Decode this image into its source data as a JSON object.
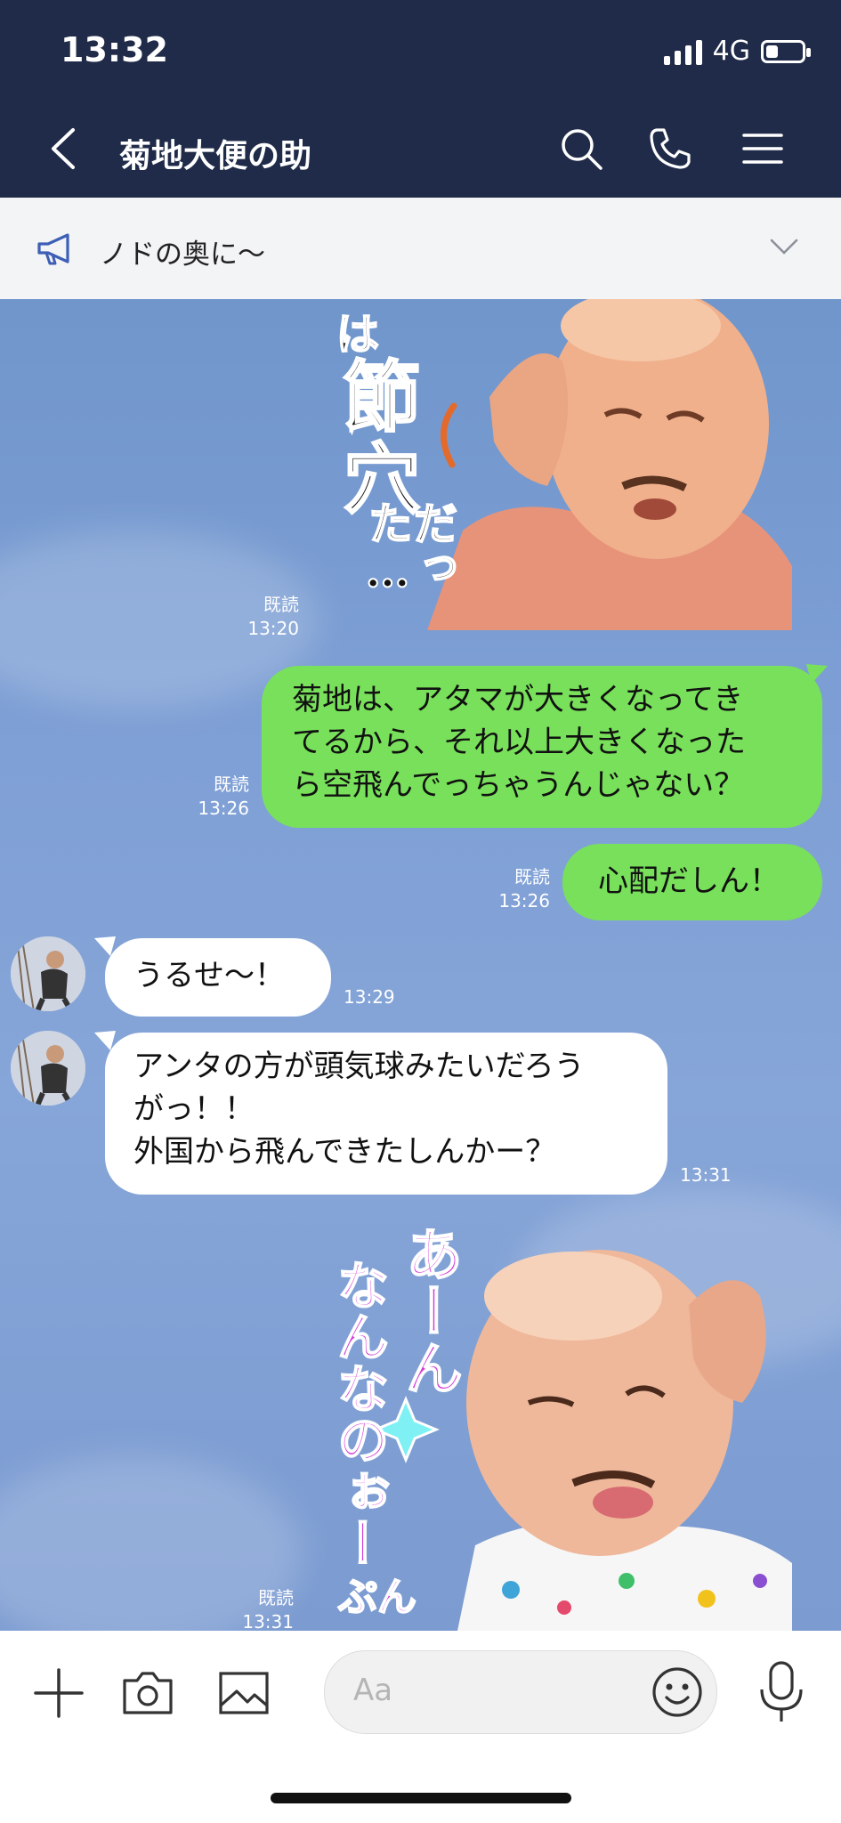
{
  "status": {
    "time": "13:32",
    "network": "4G",
    "battery_level": 0.35
  },
  "header": {
    "title": "菊地大便の助"
  },
  "announcement": {
    "text": "ノドの奥に〜"
  },
  "messages": {
    "m1": {
      "read": "既読",
      "time": "13:20",
      "sticker_text": [
        "は",
        "節",
        "穴",
        "だった…"
      ]
    },
    "m2": {
      "read": "既読",
      "time": "13:26",
      "line1": "菊地は、アタマが大きくなってき",
      "line2": "てるから、それ以上大きくなった",
      "line3": "ら空飛んでっちゃうんじゃない？"
    },
    "m3": {
      "read": "既読",
      "time": "13:26",
      "text": "心配だしん！"
    },
    "m4": {
      "time": "13:29",
      "text": "うるせ〜！"
    },
    "m5": {
      "time": "13:31",
      "line1": "アンタの方が頭気球みたいだろう",
      "line2": "がっ！！",
      "line3": "外国から飛んできたしんかー？"
    },
    "m6": {
      "read": "既読",
      "time": "13:31",
      "sticker_col1": "あーん",
      "sticker_col2": "なんなのぉー",
      "sticker_col3": "ぷん"
    }
  },
  "composer": {
    "placeholder": "Aa"
  },
  "icons": [
    "back-icon",
    "search-icon",
    "phone-icon",
    "menu-icon",
    "megaphone-icon",
    "chevron-down-icon",
    "plus-icon",
    "camera-icon",
    "image-icon",
    "emoji-icon",
    "microphone-icon"
  ],
  "colors": {
    "header": "#1f2b48",
    "chat_bg": "#7b98cf",
    "bubble_out": "#78e05a",
    "bubble_in": "#ffffff"
  }
}
